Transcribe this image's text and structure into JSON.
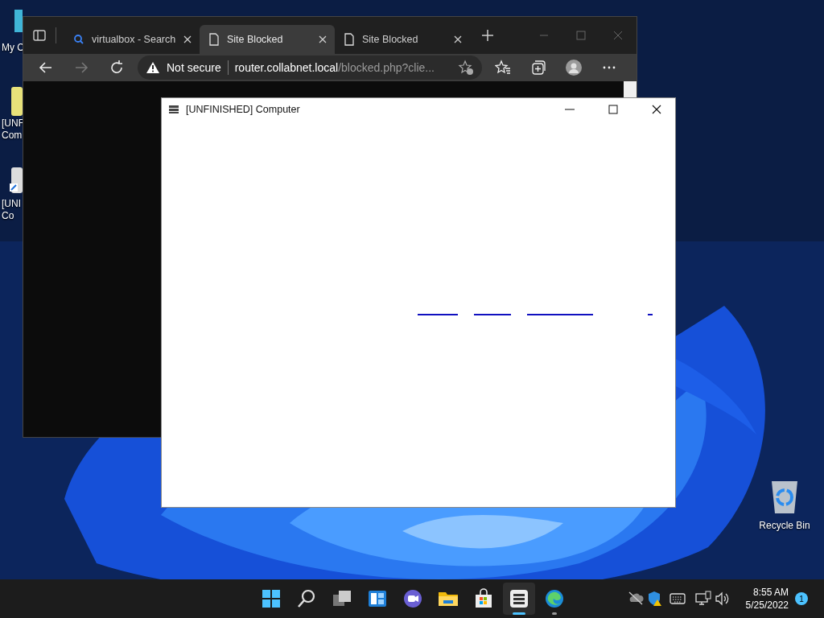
{
  "desktop_icons": [
    {
      "kind": "computer",
      "lines": [
        "My C"
      ]
    },
    {
      "kind": "folder",
      "lines": [
        "[UNF",
        "Com"
      ]
    },
    {
      "kind": "shortcut",
      "lines": [
        "[UNI",
        "Co"
      ]
    }
  ],
  "recycle_bin": {
    "label": "Recycle Bin"
  },
  "browser": {
    "tabs": [
      {
        "kind": "search",
        "title": "virtualbox - Search",
        "selected": false
      },
      {
        "kind": "page",
        "title": "Site Blocked",
        "selected": true
      },
      {
        "kind": "page",
        "title": "Site Blocked",
        "selected": false
      }
    ],
    "address": {
      "security": "Not secure",
      "host": "router.collabnet.local",
      "path": "/blocked.php?clie..."
    }
  },
  "app_window": {
    "title": "[UNFINISHED] Computer"
  },
  "taskbar": {
    "apps": [
      {
        "kind": "start",
        "active": false,
        "running": false
      },
      {
        "kind": "search",
        "active": false,
        "running": false
      },
      {
        "kind": "task-view",
        "active": false,
        "running": false
      },
      {
        "kind": "widgets",
        "active": false,
        "running": false
      },
      {
        "kind": "chat",
        "active": false,
        "running": false
      },
      {
        "kind": "explorer",
        "active": false,
        "running": false
      },
      {
        "kind": "store",
        "active": false,
        "running": false
      },
      {
        "kind": "app",
        "active": true,
        "running": true
      },
      {
        "kind": "edge",
        "active": false,
        "running": true
      }
    ],
    "time": "8:55 AM",
    "date": "5/25/2022",
    "notifications": "1"
  }
}
